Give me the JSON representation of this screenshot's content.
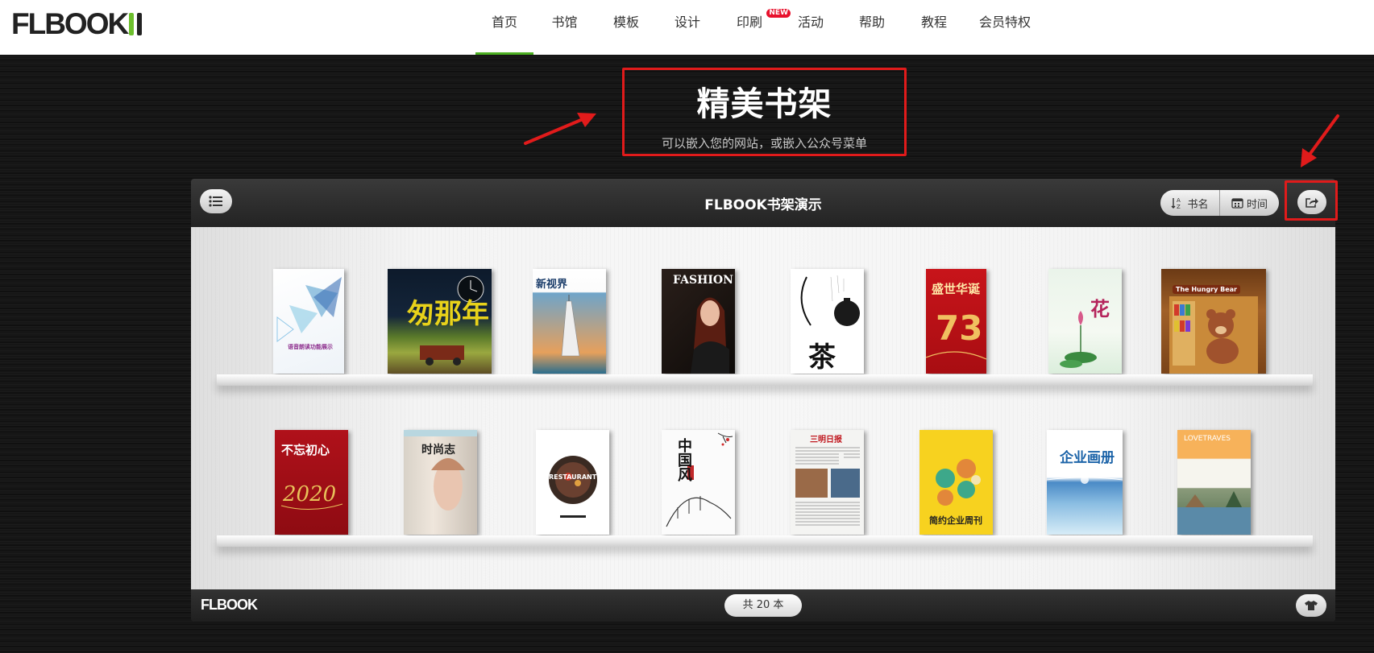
{
  "logo": {
    "text": "FLBOOK"
  },
  "nav": [
    {
      "label": "首页",
      "active": true
    },
    {
      "label": "书馆"
    },
    {
      "label": "模板"
    },
    {
      "label": "设计"
    },
    {
      "label": "印刷",
      "badge": "NEW"
    },
    {
      "label": "活动"
    },
    {
      "label": "帮助"
    },
    {
      "label": "教程"
    },
    {
      "label": "会员特权"
    }
  ],
  "hero": {
    "title": "精美书架",
    "subtitle": "可以嵌入您的网站，或嵌入公众号菜单"
  },
  "bookcase": {
    "title": "FLBOOK书架演示",
    "sort_name_label": "书名",
    "sort_time_label": "时间",
    "footer_logo": "FLBOOK",
    "count_label": "共 20 本"
  },
  "books": {
    "shelf1": [
      {
        "text": "语音朗读功能展示"
      },
      {
        "text": "匆那年"
      },
      {
        "text": "新视界"
      },
      {
        "text": "FASHION"
      },
      {
        "text": "茶"
      },
      {
        "text": "盛世华诞"
      },
      {
        "text": "花"
      },
      {
        "text": "The Hungry Bear"
      }
    ],
    "shelf2": [
      {
        "text": "不忘初心"
      },
      {
        "text": "时尚志"
      },
      {
        "text": "RESTAURANT"
      },
      {
        "text": "中国风"
      },
      {
        "text": "三明日报"
      },
      {
        "text": "简约企业周刊"
      },
      {
        "text": "企业画册"
      },
      {
        "text": "LOVETRAVES"
      }
    ]
  },
  "colors": {
    "accent_green": "#4caf22",
    "highlight_red": "#e11b1b",
    "badge_red": "#e8112d"
  }
}
